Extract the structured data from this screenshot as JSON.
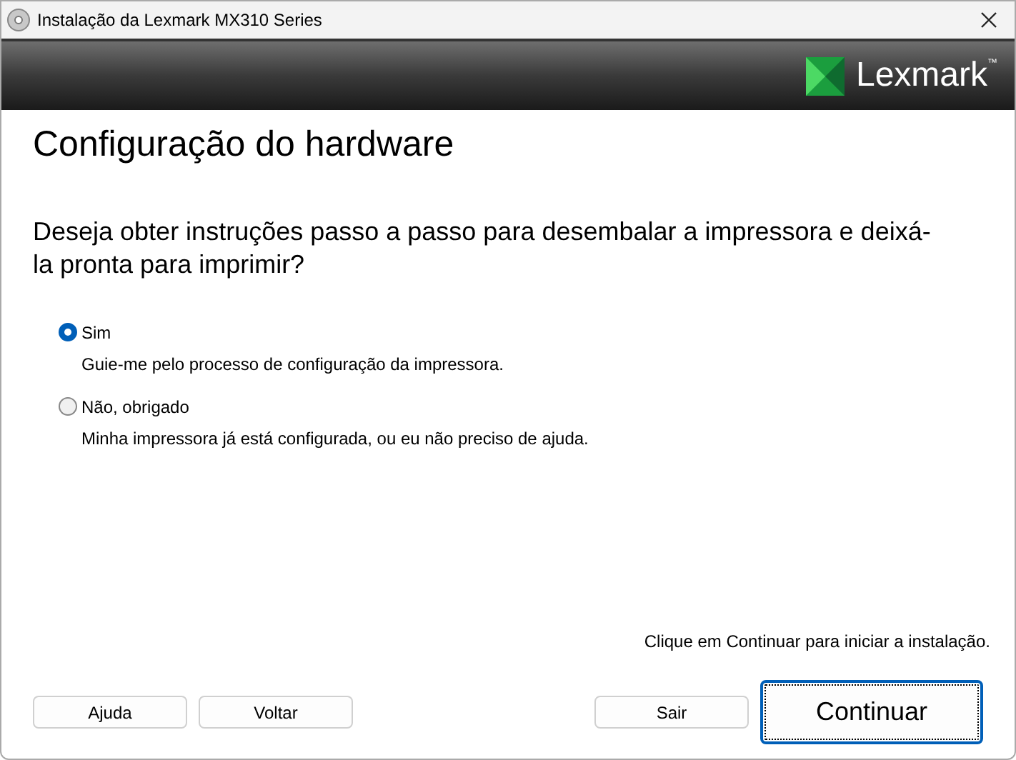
{
  "window": {
    "title": "Instalação da Lexmark MX310 Series"
  },
  "header": {
    "logo_text": "Lexmark",
    "trademark": "™"
  },
  "heading": "Configuração do hardware",
  "question": "Deseja obter instruções passo a passo para desembalar a impressora e deixá-la pronta para imprimir?",
  "options": [
    {
      "label": "Sim",
      "description": "Guie-me pelo processo de configuração da impressora.",
      "selected": true
    },
    {
      "label": "Não, obrigado",
      "description": "Minha impressora já está configurada, ou eu não preciso de ajuda.",
      "selected": false
    }
  ],
  "hint": "Clique em Continuar para iniciar a instalação.",
  "buttons": [
    {
      "label": "Ajuda",
      "kind": "secondary"
    },
    {
      "label": "Voltar",
      "kind": "secondary"
    },
    {
      "label": "Sair",
      "kind": "secondary"
    },
    {
      "label": "Continuar",
      "kind": "primary"
    }
  ]
}
